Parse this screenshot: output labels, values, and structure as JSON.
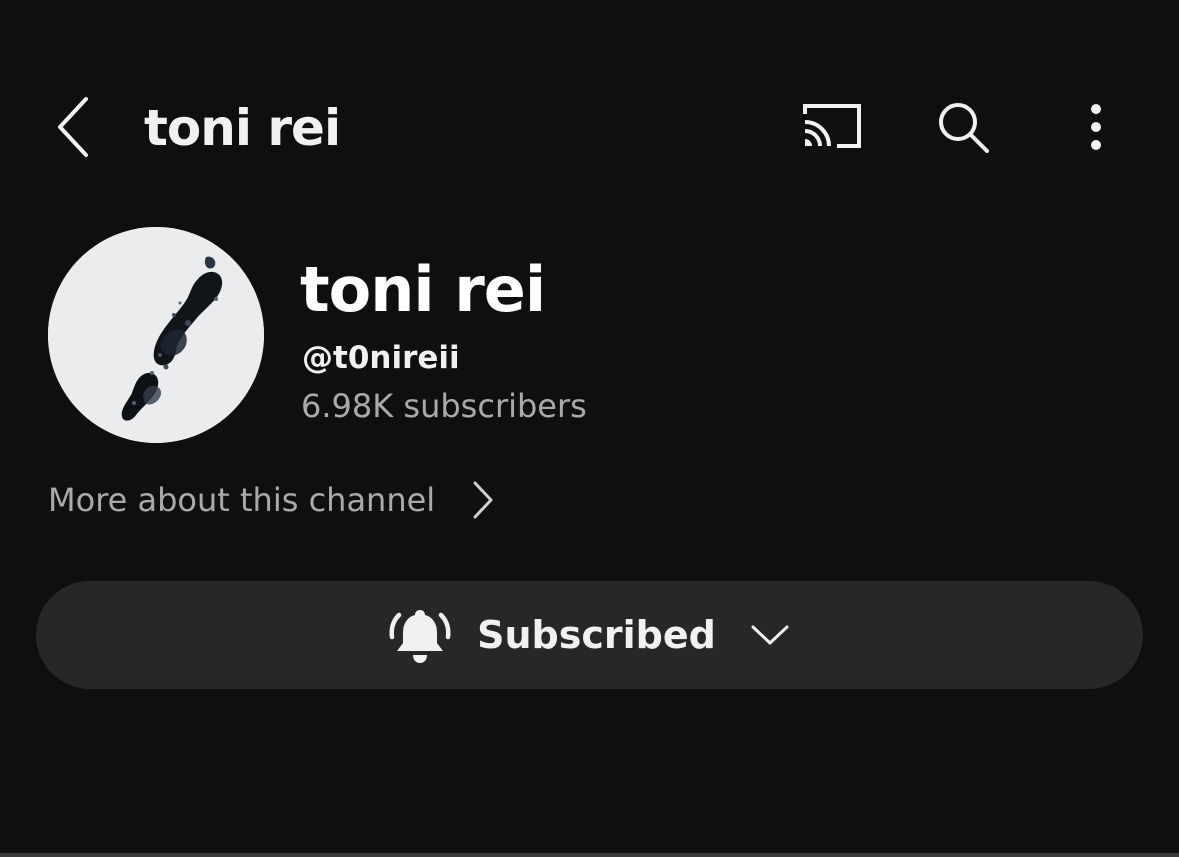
{
  "header": {
    "title": "toni rei",
    "back_icon": "chevron-left-icon",
    "cast_icon": "cast-icon",
    "search_icon": "search-icon",
    "more_icon": "more-vertical-icon"
  },
  "channel": {
    "name": "toni rei",
    "handle": "@t0nireii",
    "subscribers": "6.98K subscribers",
    "avatar_icon": "channel-avatar"
  },
  "more_about": {
    "label": "More about this channel",
    "icon": "chevron-right-icon"
  },
  "subscribe": {
    "label": "Subscribed",
    "bell_icon": "bell-all-icon",
    "dropdown_icon": "chevron-down-icon"
  },
  "colors": {
    "background": "#0f0f0f",
    "button_bg": "#272727",
    "primary_text": "#f1f1f1",
    "secondary_text": "#aaaaaa"
  }
}
